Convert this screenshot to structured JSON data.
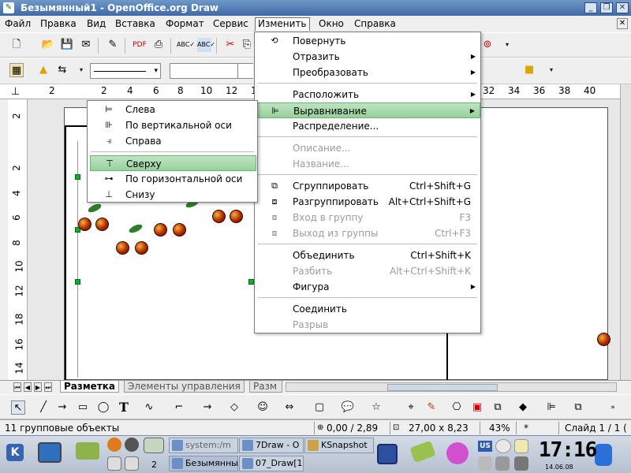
{
  "window": {
    "title": "Безымянный1 - OpenOffice.org Draw",
    "app_icon": "draw-icon"
  },
  "menubar": {
    "items": [
      "Файл",
      "Правка",
      "Вид",
      "Вставка",
      "Формат",
      "Сервис",
      "Изменить",
      "Окно",
      "Справка"
    ],
    "active": "Изменить"
  },
  "toolbar2": {
    "line_width": "",
    "color_field": ""
  },
  "ruler_top": [
    "2",
    "2",
    "4",
    "6",
    "8",
    "10",
    "12",
    "1",
    "32",
    "34",
    "36",
    "38",
    "40"
  ],
  "ruler_left": [
    "2",
    "2",
    "4",
    "6",
    "8",
    "10",
    "12",
    "18",
    "16",
    "14"
  ],
  "modify_menu": {
    "items": [
      {
        "label": "Повернуть",
        "icon": "rotate-icon"
      },
      {
        "label": "Отразить",
        "submenu": true
      },
      {
        "label": "Преобразовать",
        "submenu": true
      },
      {
        "label": "Расположить",
        "submenu": true
      },
      {
        "label": "Выравнивание",
        "submenu": true,
        "icon": "align-icon",
        "hover": true
      },
      {
        "label": "Распределение..."
      },
      {
        "label": "Описание...",
        "disabled": true
      },
      {
        "label": "Название...",
        "disabled": true
      },
      {
        "label": "Сгруппировать",
        "shortcut": "Ctrl+Shift+G",
        "icon": "group-icon"
      },
      {
        "label": "Разгруппировать",
        "shortcut": "Alt+Ctrl+Shift+G",
        "icon": "ungroup-icon"
      },
      {
        "label": "Вход в группу",
        "shortcut": "F3",
        "disabled": true,
        "icon": "enter-group-icon"
      },
      {
        "label": "Выход из группы",
        "shortcut": "Ctrl+F3",
        "disabled": true,
        "icon": "exit-group-icon"
      },
      {
        "label": "Объединить",
        "shortcut": "Ctrl+Shift+K"
      },
      {
        "label": "Разбить",
        "shortcut": "Alt+Ctrl+Shift+K",
        "disabled": true
      },
      {
        "label": "Фигура",
        "submenu": true
      },
      {
        "label": "Соединить"
      },
      {
        "label": "Разрыв",
        "disabled": true
      }
    ]
  },
  "align_submenu": {
    "items": [
      {
        "label": "Слева",
        "icon": "align-left-icon"
      },
      {
        "label": "По вертикальной оси",
        "icon": "align-center-icon"
      },
      {
        "label": "Справа",
        "icon": "align-right-icon"
      },
      {
        "label": "Сверху",
        "icon": "align-top-icon",
        "hover": true
      },
      {
        "label": "По горизонтальной оси",
        "icon": "align-middle-icon"
      },
      {
        "label": "Снизу",
        "icon": "align-bottom-icon"
      }
    ]
  },
  "tabs": [
    "Разметка",
    "Элементы управления",
    "Разм"
  ],
  "statusbar": {
    "selection": "11 групповые объекты",
    "position": "0,00 / 2,89",
    "size": "27,00 x 8,23",
    "zoom": "43%",
    "modified": "*",
    "slide": "Слайд 1 / 1 ("
  },
  "taskbar": {
    "desktop_label": "2",
    "tasks": [
      {
        "label": "system:/m"
      },
      {
        "label": "7Draw - O"
      },
      {
        "label": "KSnapshot"
      },
      {
        "label": "Безымянны"
      },
      {
        "label": "07_Draw[1"
      }
    ],
    "keyboard_layout": "US",
    "clock_time": "17:16",
    "clock_date": "14.06.08"
  }
}
